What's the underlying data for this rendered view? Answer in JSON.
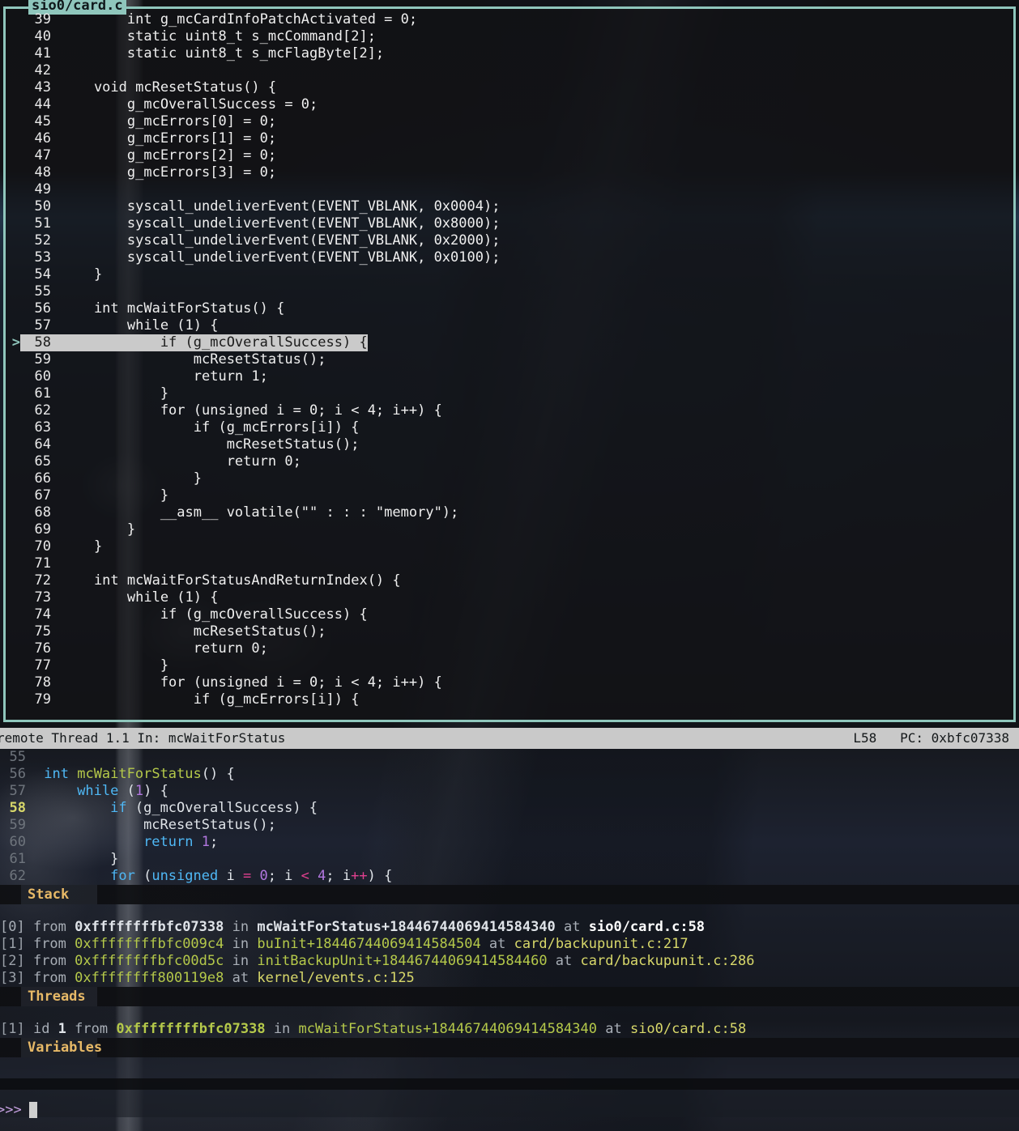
{
  "window": {
    "title": "sio0/card.c"
  },
  "source_tui": {
    "current_line": 58,
    "marker": ">",
    "lines": [
      {
        "num": "39",
        "text": "        int g_mcCardInfoPatchActivated = 0;"
      },
      {
        "num": "40",
        "text": "        static uint8_t s_mcCommand[2];"
      },
      {
        "num": "41",
        "text": "        static uint8_t s_mcFlagByte[2];"
      },
      {
        "num": "42",
        "text": ""
      },
      {
        "num": "43",
        "text": "    void mcResetStatus() {"
      },
      {
        "num": "44",
        "text": "        g_mcOverallSuccess = 0;"
      },
      {
        "num": "45",
        "text": "        g_mcErrors[0] = 0;"
      },
      {
        "num": "46",
        "text": "        g_mcErrors[1] = 0;"
      },
      {
        "num": "47",
        "text": "        g_mcErrors[2] = 0;"
      },
      {
        "num": "48",
        "text": "        g_mcErrors[3] = 0;"
      },
      {
        "num": "49",
        "text": ""
      },
      {
        "num": "50",
        "text": "        syscall_undeliverEvent(EVENT_VBLANK, 0x0004);"
      },
      {
        "num": "51",
        "text": "        syscall_undeliverEvent(EVENT_VBLANK, 0x8000);"
      },
      {
        "num": "52",
        "text": "        syscall_undeliverEvent(EVENT_VBLANK, 0x2000);"
      },
      {
        "num": "53",
        "text": "        syscall_undeliverEvent(EVENT_VBLANK, 0x0100);"
      },
      {
        "num": "54",
        "text": "    }"
      },
      {
        "num": "55",
        "text": ""
      },
      {
        "num": "56",
        "text": "    int mcWaitForStatus() {"
      },
      {
        "num": "57",
        "text": "        while (1) {"
      },
      {
        "num": "58",
        "text": "            if (g_mcOverallSuccess) {"
      },
      {
        "num": "59",
        "text": "                mcResetStatus();"
      },
      {
        "num": "60",
        "text": "                return 1;"
      },
      {
        "num": "61",
        "text": "            }"
      },
      {
        "num": "62",
        "text": "            for (unsigned i = 0; i < 4; i++) {"
      },
      {
        "num": "63",
        "text": "                if (g_mcErrors[i]) {"
      },
      {
        "num": "64",
        "text": "                    mcResetStatus();"
      },
      {
        "num": "65",
        "text": "                    return 0;"
      },
      {
        "num": "66",
        "text": "                }"
      },
      {
        "num": "67",
        "text": "            }"
      },
      {
        "num": "68",
        "text": "            __asm__ volatile(\"\" : : : \"memory\");"
      },
      {
        "num": "69",
        "text": "        }"
      },
      {
        "num": "70",
        "text": "    }"
      },
      {
        "num": "71",
        "text": ""
      },
      {
        "num": "72",
        "text": "    int mcWaitForStatusAndReturnIndex() {"
      },
      {
        "num": "73",
        "text": "        while (1) {"
      },
      {
        "num": "74",
        "text": "            if (g_mcOverallSuccess) {"
      },
      {
        "num": "75",
        "text": "                mcResetStatus();"
      },
      {
        "num": "76",
        "text": "                return 0;"
      },
      {
        "num": "77",
        "text": "            }"
      },
      {
        "num": "78",
        "text": "            for (unsigned i = 0; i < 4; i++) {"
      },
      {
        "num": "79",
        "text": "                if (g_mcErrors[i]) {"
      }
    ]
  },
  "status_bar": {
    "left": "remote Thread 1.1 In: mcWaitForStatus",
    "line_label": "L58",
    "pc_label": "PC: 0xbfc07338"
  },
  "dashboard": {
    "source": {
      "active_line": "58",
      "lines": [
        {
          "num": "55",
          "active": false,
          "tokens": []
        },
        {
          "num": "56",
          "active": false,
          "tokens": [
            {
              "t": " ",
              "c": "pu"
            },
            {
              "t": "int",
              "c": "k"
            },
            {
              "t": " ",
              "c": "pu"
            },
            {
              "t": "mcWaitForStatus",
              "c": "fn"
            },
            {
              "t": "() {",
              "c": "pu"
            }
          ]
        },
        {
          "num": "57",
          "active": false,
          "tokens": [
            {
              "t": "     ",
              "c": "pu"
            },
            {
              "t": "while",
              "c": "k"
            },
            {
              "t": " (",
              "c": "pu"
            },
            {
              "t": "1",
              "c": "num"
            },
            {
              "t": ") {",
              "c": "pu"
            }
          ]
        },
        {
          "num": "58",
          "active": true,
          "tokens": [
            {
              "t": "         ",
              "c": "pu"
            },
            {
              "t": "if",
              "c": "k"
            },
            {
              "t": " (",
              "c": "pu"
            },
            {
              "t": "g_mcOverallSuccess",
              "c": "id"
            },
            {
              "t": ") {",
              "c": "pu"
            }
          ]
        },
        {
          "num": "59",
          "active": false,
          "tokens": [
            {
              "t": "             ",
              "c": "pu"
            },
            {
              "t": "mcResetStatus",
              "c": "id"
            },
            {
              "t": "();",
              "c": "pu"
            }
          ]
        },
        {
          "num": "60",
          "active": false,
          "tokens": [
            {
              "t": "             ",
              "c": "pu"
            },
            {
              "t": "return",
              "c": "k"
            },
            {
              "t": " ",
              "c": "pu"
            },
            {
              "t": "1",
              "c": "num"
            },
            {
              "t": ";",
              "c": "pu"
            }
          ]
        },
        {
          "num": "61",
          "active": false,
          "tokens": [
            {
              "t": "         }",
              "c": "pu"
            }
          ]
        },
        {
          "num": "62",
          "active": false,
          "tokens": [
            {
              "t": "         ",
              "c": "pu"
            },
            {
              "t": "for",
              "c": "k"
            },
            {
              "t": " (",
              "c": "pu"
            },
            {
              "t": "unsigned",
              "c": "k"
            },
            {
              "t": " i ",
              "c": "id"
            },
            {
              "t": "=",
              "c": "op"
            },
            {
              "t": " ",
              "c": "pu"
            },
            {
              "t": "0",
              "c": "num"
            },
            {
              "t": "; i ",
              "c": "id"
            },
            {
              "t": "<",
              "c": "op"
            },
            {
              "t": " ",
              "c": "pu"
            },
            {
              "t": "4",
              "c": "num"
            },
            {
              "t": "; i",
              "c": "id"
            },
            {
              "t": "++",
              "c": "op"
            },
            {
              "t": ") {",
              "c": "pu"
            }
          ]
        }
      ]
    },
    "stack": {
      "header": "Stack",
      "frames": [
        {
          "index": "[0]",
          "from": "from",
          "addr": "0xffffffffbfc07338",
          "in": "in",
          "func": "mcWaitForStatus",
          "offset": "+18446744069414584340",
          "at": "at",
          "location": "sio0/card.c:58",
          "selected": true
        },
        {
          "index": "[1]",
          "from": "from",
          "addr": "0xffffffffbfc009c4",
          "in": "in",
          "func": "buInit",
          "offset": "+18446744069414584504",
          "at": "at",
          "location": "card/backupunit.c:217",
          "selected": false
        },
        {
          "index": "[2]",
          "from": "from",
          "addr": "0xffffffffbfc00d5c",
          "in": "in",
          "func": "initBackupUnit",
          "offset": "+18446744069414584460",
          "at": "at",
          "location": "card/backupunit.c:286",
          "selected": false
        },
        {
          "index": "[3]",
          "from": "from",
          "addr": "0xffffffff800119e8",
          "in": "in",
          "func": "",
          "offset": "",
          "at": "at",
          "location": "kernel/events.c:125",
          "selected": false
        }
      ]
    },
    "threads": {
      "header": "Threads",
      "rows": [
        {
          "index": "[1]",
          "id_label": "id",
          "id": "1",
          "from": "from",
          "addr": "0xffffffffbfc07338",
          "in": "in",
          "func": "mcWaitForStatus",
          "offset": "+18446744069414584340",
          "at": "at",
          "location": "sio0/card.c:58"
        }
      ]
    },
    "variables": {
      "header": "Variables",
      "rows": []
    }
  },
  "prompt": {
    "symbol": ">>>",
    "value": ""
  },
  "colors": {
    "border_teal": "#8fc6bc",
    "status_bar_bg": "#c9c9c9",
    "section_header": "#e7b967",
    "keyword": "#4fb8f5",
    "function": "#b5c94a",
    "number": "#b277e0",
    "operator": "#e0408f",
    "prompt": "#c5a0e0",
    "current_line_highlight": "#cacaca"
  }
}
